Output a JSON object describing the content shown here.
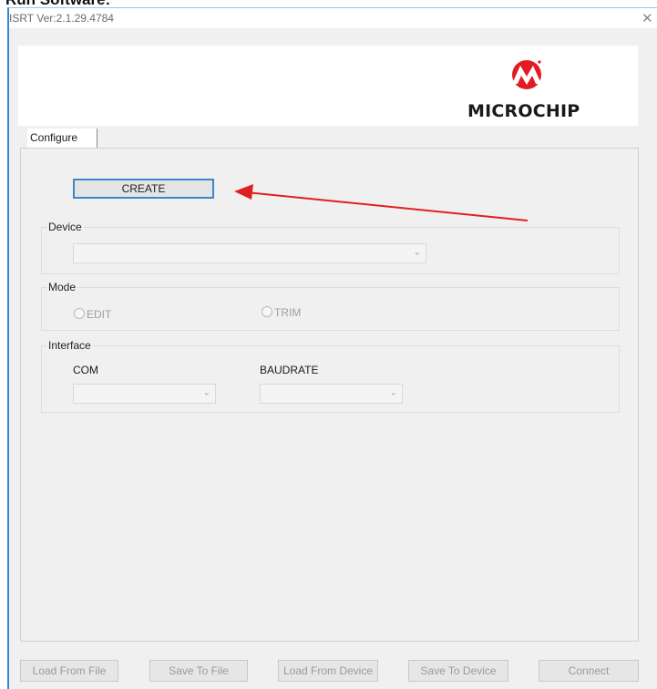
{
  "page": {
    "heading": "Run Software:"
  },
  "window": {
    "title": "ISRT Ver:2.1.29.4784",
    "close_glyph": "✕",
    "brand_logo_text": "MICROCHIP",
    "brand_color": "#e31b23"
  },
  "tabs": [
    {
      "label": "Configure",
      "selected": true
    }
  ],
  "configure": {
    "create_label": "CREATE",
    "device": {
      "label": "Device",
      "value": ""
    },
    "mode": {
      "label": "Mode",
      "options": [
        {
          "label": "EDIT",
          "selected": false
        },
        {
          "label": "TRIM",
          "selected": false
        }
      ]
    },
    "interface": {
      "label": "Interface",
      "com_label": "COM",
      "com_value": "",
      "baudrate_label": "BAUDRATE",
      "baudrate_value": ""
    }
  },
  "bottom_buttons": [
    {
      "label": "Load From File",
      "enabled": false
    },
    {
      "label": "Save To File",
      "enabled": false
    },
    {
      "label": "Load From Device",
      "enabled": false
    },
    {
      "label": "Save To Device",
      "enabled": false
    },
    {
      "label": "Connect",
      "enabled": false
    }
  ],
  "annotation": {
    "arrow_color": "#e02020",
    "points_to": "CREATE"
  }
}
